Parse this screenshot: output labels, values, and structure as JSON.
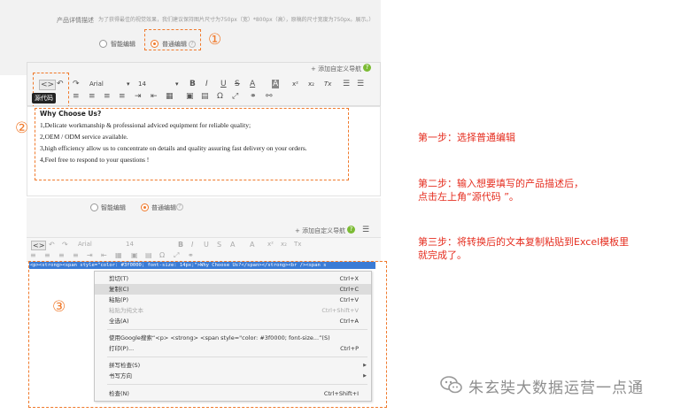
{
  "top_panel": {
    "field_label": "产品详情描述",
    "field_hint": "为了获得最佳的视觉效果，我们建议保持图片尺寸为750px（宽）*800px（高），原稿的尺寸宽度为750px。展示。）",
    "options": [
      "智能编辑",
      "普通编辑"
    ],
    "selected_option": "普通编辑",
    "marker_1": "①",
    "nav_link": "+ 添加自定义导航",
    "help_glyph": "?",
    "toolbar": {
      "source_label": "<>",
      "source_tooltip": "源代码",
      "font_name": "Arial",
      "font_size": "14",
      "bold": "B",
      "italic": "I",
      "underline": "U",
      "strike": "S",
      "font_color": "A",
      "bg_color": "A",
      "superscript": "x²",
      "subscript": "x₂",
      "clear": "Tx"
    },
    "marker_2": "②",
    "content": {
      "title": "Why Choose Us?",
      "lines": [
        "1,Delicate workmanship & professional adviced equipment for reliable quality;",
        "2,OEM / ODM service available.",
        "3,high efficiency allow us to concentrate on details and quality assuring fast delivery on your orders.",
        "4,Feel free to respond to your questions !"
      ]
    }
  },
  "bottom_panel": {
    "options": [
      "智能编辑",
      "普通编辑"
    ],
    "nav_link": "+ 添加自定义导航",
    "font_name": "Arial",
    "font_size": "14",
    "code_text": "<p><strong><span style=\"color: #3f0000; font-size: 14px;\">Why Choose Us?</span></strong><br /><span s",
    "marker_3": "③",
    "context_menu": [
      {
        "label": "剪切(T)",
        "shortcut": "Ctrl+X",
        "state": "normal"
      },
      {
        "label": "复制(C)",
        "shortcut": "Ctrl+C",
        "state": "highlight"
      },
      {
        "label": "粘贴(P)",
        "shortcut": "Ctrl+V",
        "state": "normal"
      },
      {
        "label": "粘贴为纯文本",
        "shortcut": "Ctrl+Shift+V",
        "state": "disabled"
      },
      {
        "label": "全选(A)",
        "shortcut": "Ctrl+A",
        "state": "normal"
      },
      {
        "label": "使用Google搜索“<p> <strong> <span style=\"color: #3f0000; font-size...”(S)",
        "shortcut": "",
        "state": "normal"
      },
      {
        "label": "打印(P)...",
        "shortcut": "Ctrl+P",
        "state": "normal"
      },
      {
        "label": "拼写检查(S)",
        "shortcut": "",
        "state": "submenu"
      },
      {
        "label": "书写方向",
        "shortcut": "",
        "state": "submenu"
      },
      {
        "label": "检查(N)",
        "shortcut": "Ctrl+Shift+I",
        "state": "normal"
      }
    ]
  },
  "instructions": {
    "step1": "第一步：选择普通编辑",
    "step2_line1": "第二步：输入想要填写的产品描述后，",
    "step2_line2": "点击左上角“源代码 ”。",
    "step3_line1": "第三步：将转换后的文本复制粘贴到Excel模板里",
    "step3_line2": "就完成了。"
  },
  "watermark": "朱玄奘大数据运营一点通",
  "colors": {
    "accent": "#f07a2c",
    "step_text": "#e52d1f",
    "selection": "#3a7bd5",
    "help_green": "#7cbb34"
  }
}
